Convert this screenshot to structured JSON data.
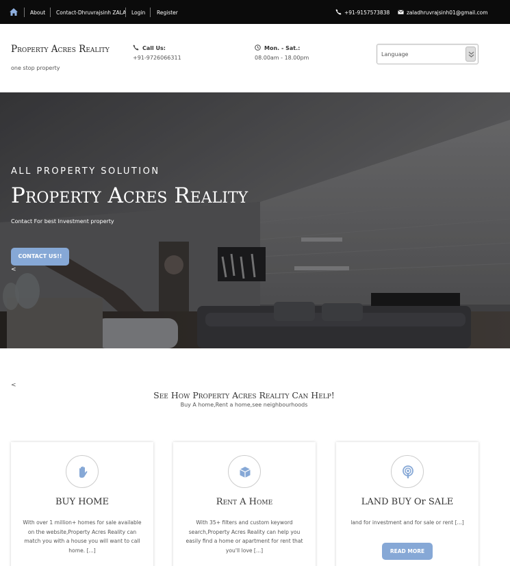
{
  "topbar": {
    "links": [
      "About",
      "Contact-Dhruvrajsinh ZALA",
      "Login",
      "Register"
    ],
    "phone": "+91-9157573838",
    "email": "zaladhruvrajsinh01@gmail.com"
  },
  "header": {
    "brand": "Property Acres Reality",
    "tagline": "one stop property",
    "call_label": "Call Us:",
    "call_value": "+91-9726066311",
    "hours_label": "Mon. - Sat.:",
    "hours_value": "08.00am - 18.00pm",
    "language_placeholder": "Language"
  },
  "hero": {
    "kicker": "ALL PROPERTY SOLUTION",
    "title": "Property Acres Reality",
    "subtitle": "Contact For best Investment property",
    "button": "CONTACT US!!",
    "arrow": "<"
  },
  "section": {
    "arrow": "<",
    "title": "See How Property Acres Reality Can Help!",
    "subtitle": "Buy A home,Rent a home,see neighbourhoods"
  },
  "cards": [
    {
      "icon": "hand-icon",
      "title": "BUY HOME",
      "text": "With over 1 million+ homes for sale available on the website,Property Acres Reality can match you with a house you will want to call home. [...]"
    },
    {
      "icon": "box-icon",
      "title": "Rent A Home",
      "text": "With 35+ filters and custom keyword search,Property Acres Reality can help you easily find a home or apartment for rent that you'll love [...]"
    },
    {
      "icon": "podcast-icon",
      "title": "LAND BUY Or SALE",
      "text": "land for investment and for sale or rent [...]",
      "button": "READ MORE"
    }
  ],
  "colors": {
    "accent": "#86a8d6",
    "topbar": "#0b0b0b"
  }
}
